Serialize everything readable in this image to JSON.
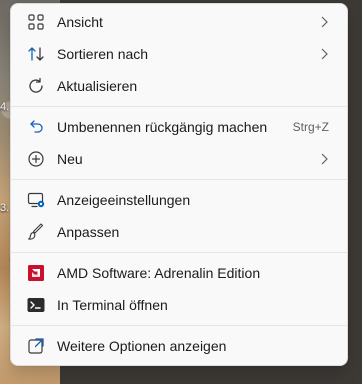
{
  "desktop": {
    "labels": [
      "4.",
      "3."
    ]
  },
  "menu": {
    "items": [
      {
        "label": "Ansicht",
        "icon": "grid-icon",
        "submenu": true
      },
      {
        "label": "Sortieren nach",
        "icon": "sort-arrows-icon",
        "submenu": true
      },
      {
        "label": "Aktualisieren",
        "icon": "refresh-icon",
        "submenu": false
      },
      {
        "label": "Umbenennen rückgängig machen",
        "icon": "undo-icon",
        "shortcut": "Strg+Z"
      },
      {
        "label": "Neu",
        "icon": "plus-circle-icon",
        "submenu": true
      },
      {
        "label": "Anzeigeeinstellungen",
        "icon": "display-settings-icon"
      },
      {
        "label": "Anpassen",
        "icon": "brush-icon"
      },
      {
        "label": "AMD Software: Adrenalin Edition",
        "icon": "amd-icon"
      },
      {
        "label": "In Terminal öffnen",
        "icon": "terminal-icon"
      },
      {
        "label": "Weitere Optionen anzeigen",
        "icon": "more-options-icon"
      }
    ]
  },
  "colors": {
    "menu_bg": "#f9f9f9",
    "accent": "#0067c0",
    "amd_red": "#c8102e"
  }
}
